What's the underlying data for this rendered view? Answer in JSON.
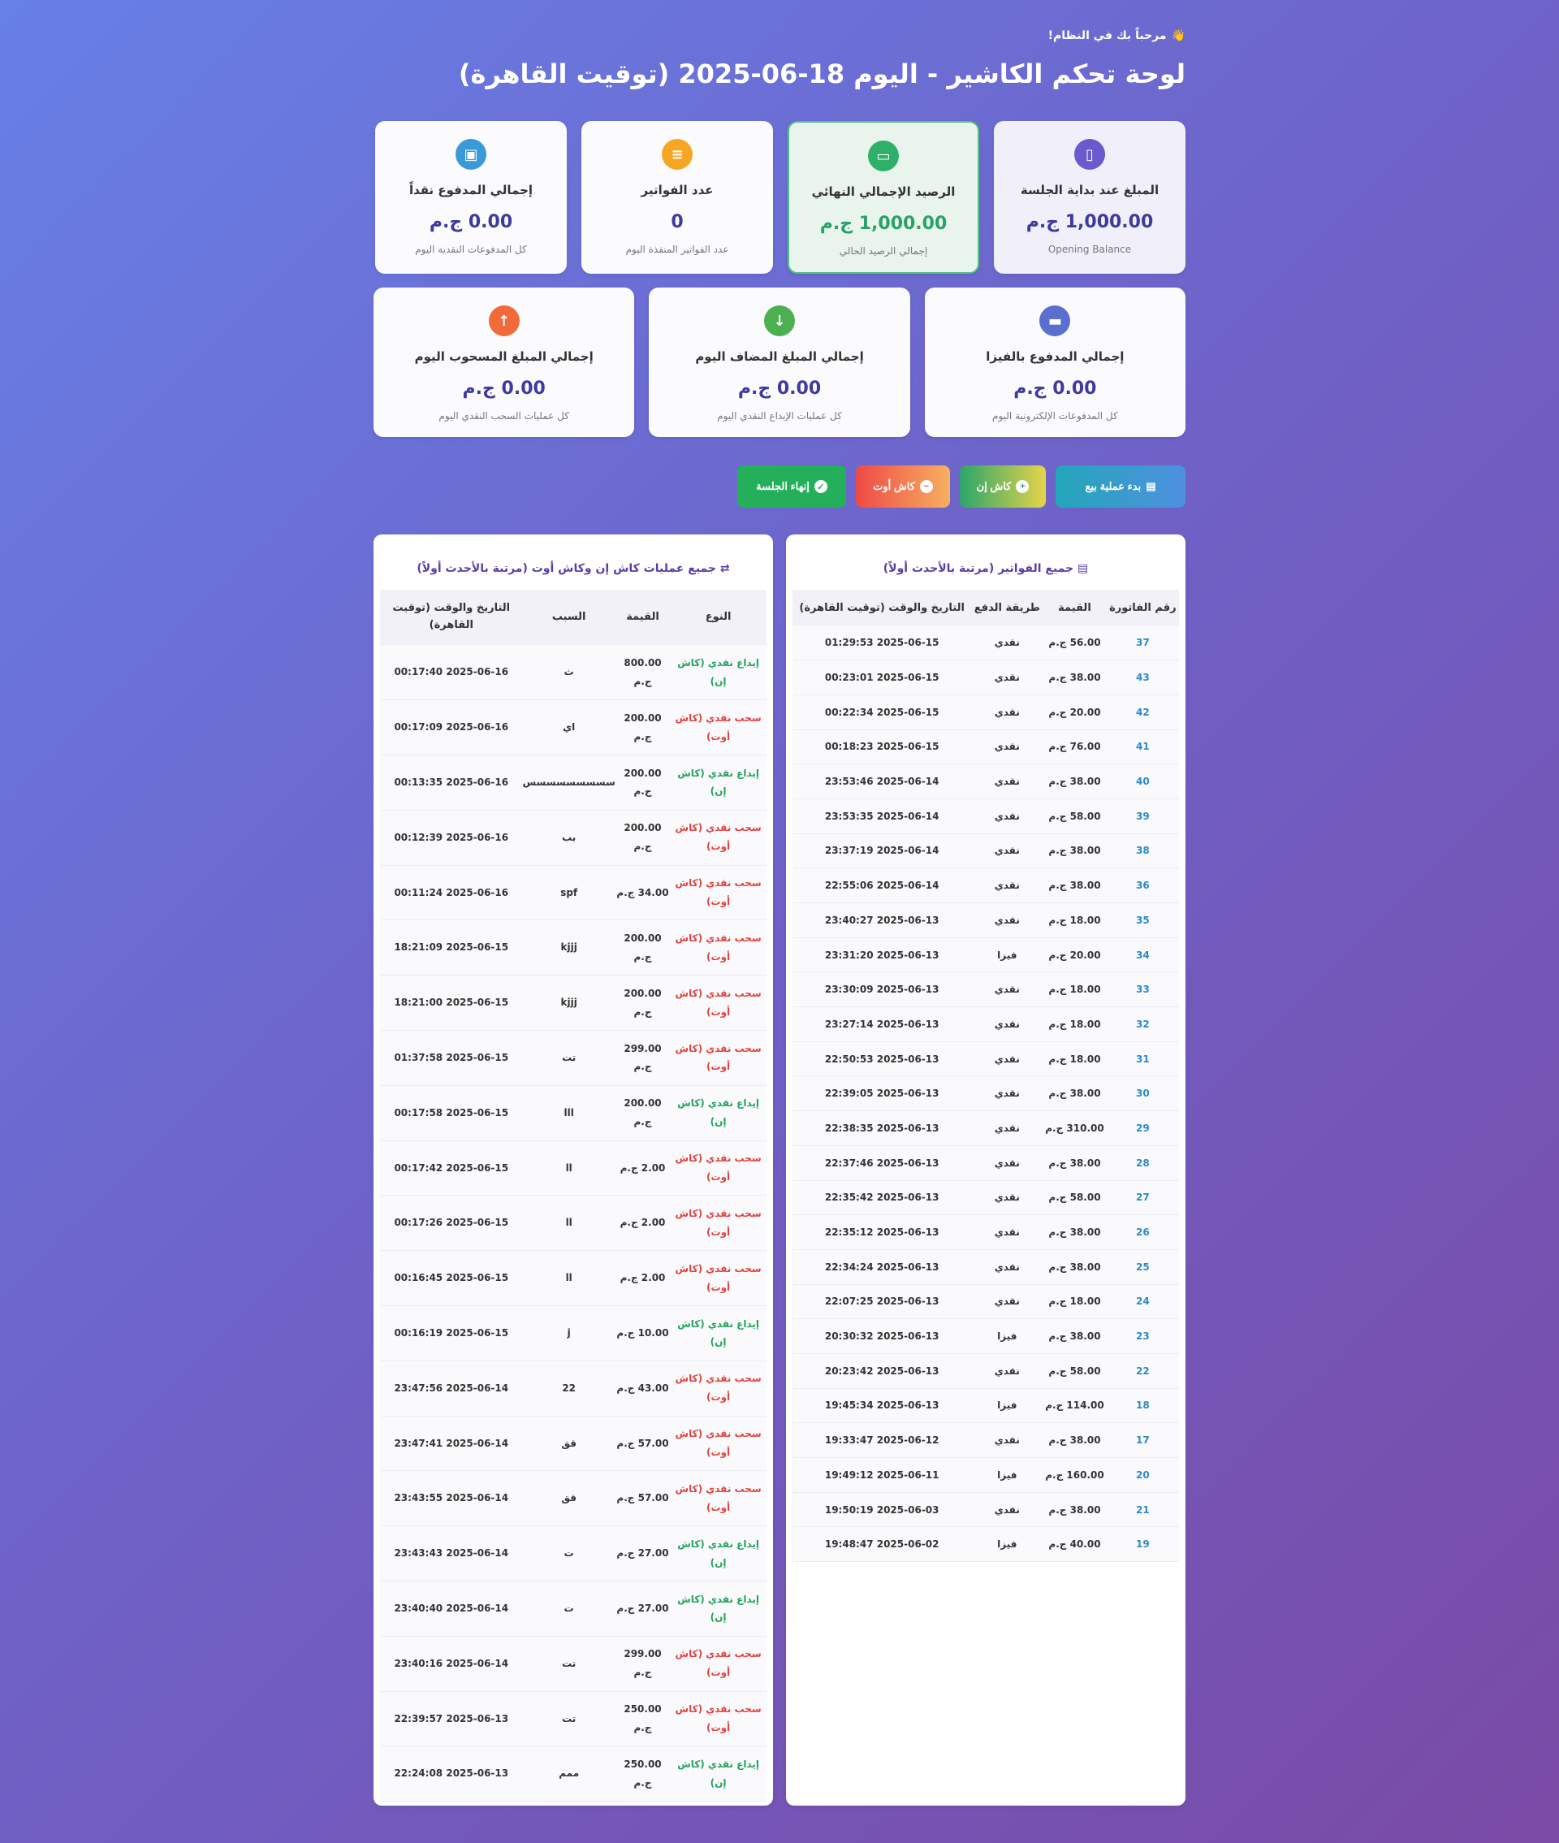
{
  "welcome": "مرحباً بك في النظام!",
  "welcome_icon": "👋",
  "title": "لوحة تحكم الكاشير - اليوم 18-06-2025 (توقيت القاهرة)",
  "cards_row1": [
    {
      "icon": "door-icon",
      "label": "المبلغ عند بداية الجلسة",
      "value": "1,000.00 ج.م",
      "sub": "Opening Balance",
      "color": "#6a5acd"
    },
    {
      "icon": "wallet-icon",
      "label": "الرصيد الإجمالي النهائي",
      "value": "1,000.00 ج.م",
      "sub": "إجمالي الرصيد الحالي",
      "color": "#2fb06a"
    },
    {
      "icon": "receipt-icon",
      "label": "عدد الفواتير",
      "value": "0",
      "sub": "عدد الفواتير المنفذة اليوم",
      "color": "#f5a623"
    },
    {
      "icon": "cash-icon",
      "label": "إجمالي المدفوع نقداً",
      "value": "0.00 ج.م",
      "sub": "كل المدفوعات النقدية اليوم",
      "color": "#3a9ad9"
    }
  ],
  "cards_row2": [
    {
      "icon": "credit-card-icon",
      "label": "إجمالي المدفوع بالفيزا",
      "value": "0.00 ج.م",
      "sub": "كل المدفوعات الإلكترونية اليوم",
      "color": "#5a6fd0"
    },
    {
      "icon": "arrow-down-circle-icon",
      "label": "إجمالي المبلغ المضاف اليوم",
      "value": "0.00 ج.م",
      "sub": "كل عمليات الإيداع النقدي اليوم",
      "color": "#4caf50"
    },
    {
      "icon": "arrow-up-circle-icon",
      "label": "إجمالي المبلغ المسحوب اليوم",
      "value": "0.00 ج.م",
      "sub": "كل عمليات السحب النقدي اليوم",
      "color": "#f06a3a"
    }
  ],
  "buttons": {
    "sale": "بدء عملية بيع",
    "cash_in": "كاش إن",
    "cash_out": "كاش أوت",
    "end": "إنهاء الجلسة"
  },
  "invoices": {
    "title": "جميع الفواتير (مرتبة بالأحدث أولاً)",
    "headers": [
      "رقم الفاتورة",
      "القيمة",
      "طريقة الدفع",
      "التاريخ والوقت (توقيت القاهرة)"
    ],
    "rows": [
      [
        "37",
        "56.00 ج.م",
        "نقدي",
        "2025-06-15 01:29:53"
      ],
      [
        "43",
        "38.00 ج.م",
        "نقدي",
        "2025-06-15 00:23:01"
      ],
      [
        "42",
        "20.00 ج.م",
        "نقدي",
        "2025-06-15 00:22:34"
      ],
      [
        "41",
        "76.00 ج.م",
        "نقدي",
        "2025-06-15 00:18:23"
      ],
      [
        "40",
        "38.00 ج.م",
        "نقدي",
        "2025-06-14 23:53:46"
      ],
      [
        "39",
        "58.00 ج.م",
        "نقدي",
        "2025-06-14 23:53:35"
      ],
      [
        "38",
        "38.00 ج.م",
        "نقدي",
        "2025-06-14 23:37:19"
      ],
      [
        "36",
        "38.00 ج.م",
        "نقدي",
        "2025-06-14 22:55:06"
      ],
      [
        "35",
        "18.00 ج.م",
        "نقدي",
        "2025-06-13 23:40:27"
      ],
      [
        "34",
        "20.00 ج.م",
        "فيزا",
        "2025-06-13 23:31:20"
      ],
      [
        "33",
        "18.00 ج.م",
        "نقدي",
        "2025-06-13 23:30:09"
      ],
      [
        "32",
        "18.00 ج.م",
        "نقدي",
        "2025-06-13 23:27:14"
      ],
      [
        "31",
        "18.00 ج.م",
        "نقدي",
        "2025-06-13 22:50:53"
      ],
      [
        "30",
        "38.00 ج.م",
        "نقدي",
        "2025-06-13 22:39:05"
      ],
      [
        "29",
        "310.00 ج.م",
        "نقدي",
        "2025-06-13 22:38:35"
      ],
      [
        "28",
        "38.00 ج.م",
        "نقدي",
        "2025-06-13 22:37:46"
      ],
      [
        "27",
        "58.00 ج.م",
        "نقدي",
        "2025-06-13 22:35:42"
      ],
      [
        "26",
        "38.00 ج.م",
        "نقدي",
        "2025-06-13 22:35:12"
      ],
      [
        "25",
        "38.00 ج.م",
        "نقدي",
        "2025-06-13 22:34:24"
      ],
      [
        "24",
        "18.00 ج.م",
        "نقدي",
        "2025-06-13 22:07:25"
      ],
      [
        "23",
        "38.00 ج.م",
        "فيزا",
        "2025-06-13 20:30:32"
      ],
      [
        "22",
        "58.00 ج.م",
        "نقدي",
        "2025-06-13 20:23:42"
      ],
      [
        "18",
        "114.00 ج.م",
        "فيزا",
        "2025-06-13 19:45:34"
      ],
      [
        "17",
        "38.00 ج.م",
        "نقدي",
        "2025-06-12 19:33:47"
      ],
      [
        "20",
        "160.00 ج.م",
        "فيزا",
        "2025-06-11 19:49:12"
      ],
      [
        "21",
        "38.00 ج.م",
        "نقدي",
        "2025-06-03 19:50:19"
      ],
      [
        "19",
        "40.00 ج.م",
        "فيزا",
        "2025-06-02 19:48:47"
      ]
    ]
  },
  "cash_ops": {
    "title": "جميع عمليات كاش إن وكاش أوت (مرتبة بالأحدث أولاً)",
    "headers": [
      "النوع",
      "القيمة",
      "السبب",
      "التاريخ والوقت (توقيت القاهرة)"
    ],
    "rows": [
      [
        "in",
        "إيداع نقدي (كاش إن)",
        "800.00 ج.م",
        "ث",
        "2025-06-16 00:17:40"
      ],
      [
        "out",
        "سحب نقدي (كاش أوت)",
        "200.00 ج.م",
        "اي",
        "2025-06-16 00:17:09"
      ],
      [
        "in",
        "إيداع نقدي (كاش إن)",
        "200.00 ج.م",
        "سسسسسسسسس",
        "2025-06-16 00:13:35"
      ],
      [
        "out",
        "سحب نقدي (كاش أوت)",
        "200.00 ج.م",
        "بب",
        "2025-06-16 00:12:39"
      ],
      [
        "out",
        "سحب نقدي (كاش أوت)",
        "34.00 ج.م",
        "spf",
        "2025-06-16 00:11:24"
      ],
      [
        "out",
        "سحب نقدي (كاش أوت)",
        "200.00 ج.م",
        "kjjj",
        "2025-06-15 18:21:09"
      ],
      [
        "out",
        "سحب نقدي (كاش أوت)",
        "200.00 ج.م",
        "kjjj",
        "2025-06-15 18:21:00"
      ],
      [
        "out",
        "سحب نقدي (كاش أوت)",
        "299.00 ج.م",
        "تت",
        "2025-06-15 01:37:58"
      ],
      [
        "in",
        "إيداع نقدي (كاش إن)",
        "200.00 ج.م",
        "lll",
        "2025-06-15 00:17:58"
      ],
      [
        "out",
        "سحب نقدي (كاش أوت)",
        "2.00 ج.م",
        "ll",
        "2025-06-15 00:17:42"
      ],
      [
        "out",
        "سحب نقدي (كاش أوت)",
        "2.00 ج.م",
        "ll",
        "2025-06-15 00:17:26"
      ],
      [
        "out",
        "سحب نقدي (كاش أوت)",
        "2.00 ج.م",
        "ll",
        "2025-06-15 00:16:45"
      ],
      [
        "in",
        "إيداع نقدي (كاش إن)",
        "10.00 ج.م",
        "j",
        "2025-06-15 00:16:19"
      ],
      [
        "out",
        "سحب نقدي (كاش أوت)",
        "43.00 ج.م",
        "22",
        "2025-06-14 23:47:56"
      ],
      [
        "out",
        "سحب نقدي (كاش أوت)",
        "57.00 ج.م",
        "قق",
        "2025-06-14 23:47:41"
      ],
      [
        "out",
        "سحب نقدي (كاش أوت)",
        "57.00 ج.م",
        "قق",
        "2025-06-14 23:43:55"
      ],
      [
        "in",
        "إيداع نقدي (كاش إن)",
        "27.00 ج.م",
        "ت",
        "2025-06-14 23:43:43"
      ],
      [
        "in",
        "إيداع نقدي (كاش إن)",
        "27.00 ج.م",
        "ت",
        "2025-06-14 23:40:40"
      ],
      [
        "out",
        "سحب نقدي (كاش أوت)",
        "299.00 ج.م",
        "تت",
        "2025-06-14 23:40:16"
      ],
      [
        "out",
        "سحب نقدي (كاش أوت)",
        "250.00 ج.م",
        "تت",
        "2025-06-13 22:39:57"
      ],
      [
        "in",
        "إيداع نقدي (كاش إن)",
        "250.00 ج.م",
        "ممم",
        "2025-06-13 22:24:08"
      ]
    ]
  }
}
